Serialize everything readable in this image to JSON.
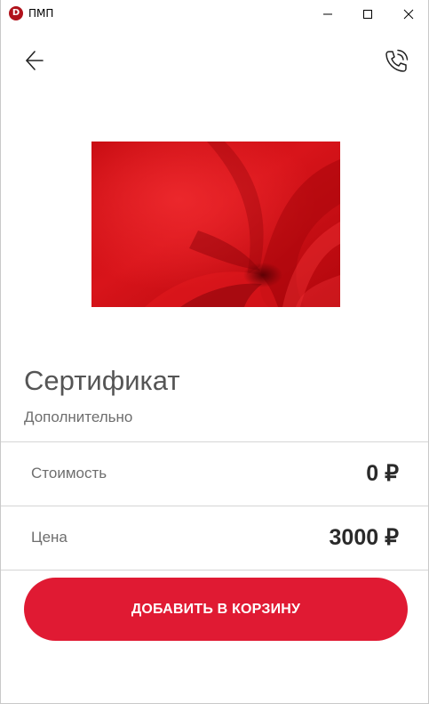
{
  "window": {
    "title": "ПМП",
    "logo_letter": "D",
    "logo_color": "#b0121b"
  },
  "header": {
    "back_icon": "arrow-left-icon",
    "call_icon": "phone-call-icon"
  },
  "product": {
    "image_alt": "red-velvet-fabric",
    "title": "Сертификат",
    "subtitle": "Дополнительно"
  },
  "rows": [
    {
      "label": "Стоимость",
      "value": "0 ₽"
    },
    {
      "label": "Цена",
      "value": "3000 ₽"
    }
  ],
  "actions": {
    "add_to_cart_label": "ДОБАВИТЬ В КОРЗИНУ",
    "accent_color": "#e01a33"
  }
}
